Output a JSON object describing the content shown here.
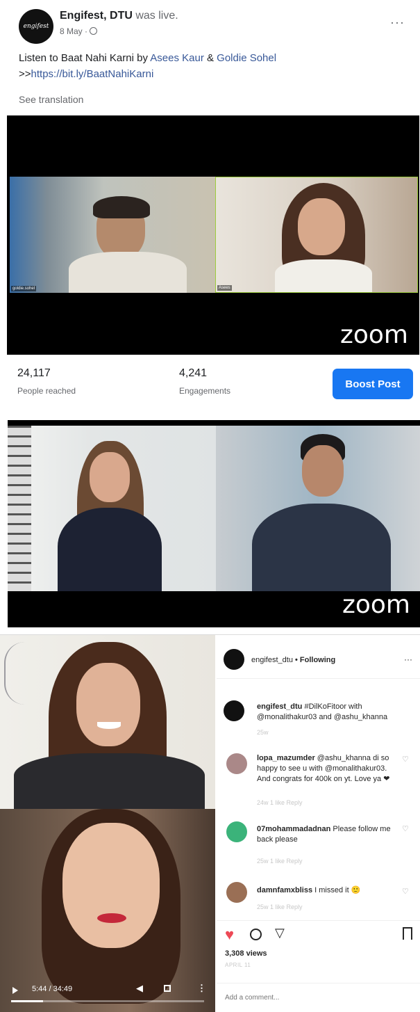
{
  "fb": {
    "page_name": "Engifest, DTU",
    "live_text": " was live.",
    "date": "8 May · ",
    "avatar_text": "engifest",
    "text_prefix": "Listen to Baat Nahi Karni by ",
    "artist1": "Asees Kaur",
    "amp": " & ",
    "artist2": "Goldie Sohel",
    "link_prefix": ">>",
    "link": "https://bit.ly/BaatNahiKarni",
    "see_translation": "See translation",
    "more": "···",
    "video1": {
      "tile_left_name": "goldie.sohel",
      "tile_right_name": "Asees",
      "logo": "zoom"
    },
    "stats": [
      {
        "value": "24,117",
        "label": "People reached"
      },
      {
        "value": "4,241",
        "label": "Engagements"
      }
    ],
    "boost_label": "Boost Post"
  },
  "video2": {
    "logo": "zoom"
  },
  "ig": {
    "header_user": "engifest_dtu",
    "header_follow": " • Following",
    "more": "···",
    "caption_user": "engifest_dtu",
    "caption_text": " #DilKoFitoor with @monalithakur03 and @ashu_khanna",
    "caption_meta": "25w",
    "comments": [
      {
        "user": "lopa_mazumder",
        "text": " @ashu_khanna di so happy to see u with @monalithakur03. And congrats for 400k on yt. Love ya ❤",
        "meta": "24w  1 like  Reply"
      },
      {
        "user": "07mohammadadnan",
        "text": " Please follow me back please",
        "meta": "25w  1 like  Reply"
      },
      {
        "user": "damnfamxbliss",
        "text": " I missed it 🙂",
        "meta": "25w  1 like  Reply"
      }
    ],
    "views": "3,308 views",
    "date": "APRIL 11",
    "add_comment_placeholder": "Add a comment...",
    "player": {
      "time": "5:44 / 34:49",
      "progress": 0.165
    }
  },
  "colors": {
    "fb_blue": "#1877f2",
    "link_blue": "#385898",
    "ig_heart": "#ed4956",
    "zoom_border": "#9ccc3d"
  }
}
